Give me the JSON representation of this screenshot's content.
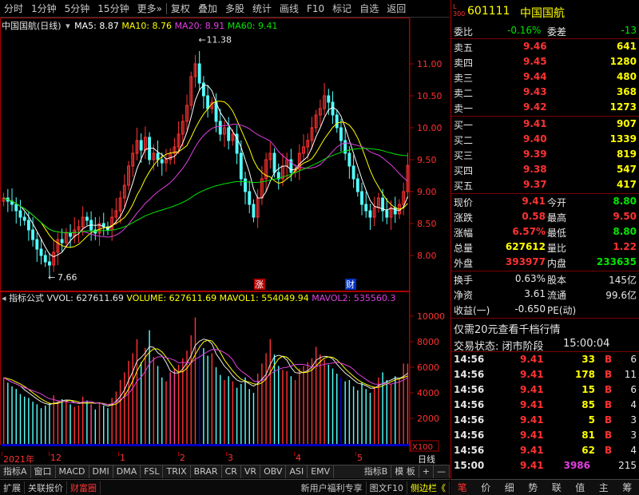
{
  "toolbar": {
    "items": [
      "分时",
      "1分钟",
      "5分钟",
      "15分钟",
      "更多»",
      "复权",
      "叠加",
      "多股",
      "统计",
      "画线",
      "F10",
      "标记",
      "自选",
      "返回"
    ]
  },
  "main_info": {
    "name": "中国国航",
    "period": "(日线)",
    "ma5": "MA5: 8.87",
    "ma10": "MA10: 8.76",
    "ma20": "MA20: 8.91",
    "ma60": "MA60: 9.41"
  },
  "markers": {
    "high": "11.38",
    "low": "7.66",
    "zhang": "涨",
    "cai": "财"
  },
  "ind_info": {
    "name": "指标公式",
    "vvol": "VVOL: 627611.69",
    "volume": "VOLUME: 627611.69",
    "mavol1": "MAVOL1: 554049.94",
    "mavol2": "MAVOL2: 535560.3"
  },
  "colors": {
    "up": "#ff3232",
    "down": "#54ffff",
    "ma5": "#ffffff",
    "ma10": "#ffff00",
    "ma20": "#e040e0",
    "ma60": "#00e600",
    "volbar_blue": "#0000ff"
  },
  "chart_data": [
    {
      "type": "candlestick",
      "title": "",
      "ylim": [
        7.5,
        11.5
      ],
      "yticks": [
        "11.00",
        "10.50",
        "10.00",
        "9.50",
        "9.00",
        "8.50",
        "8.00"
      ],
      "close": [
        8.9,
        8.85,
        8.8,
        8.7,
        8.6,
        8.55,
        8.4,
        8.25,
        8.1,
        8.0,
        7.9,
        7.85,
        8.05,
        8.25,
        8.2,
        8.35,
        8.3,
        8.4,
        8.45,
        8.6,
        8.55,
        8.4,
        8.35,
        8.5,
        8.45,
        8.4,
        8.6,
        8.7,
        8.9,
        9.1,
        9.4,
        9.6,
        9.8,
        9.65,
        9.85,
        9.5,
        9.6,
        9.5,
        9.45,
        9.5,
        9.6,
        9.7,
        9.9,
        10.1,
        10.35,
        10.8,
        11.0,
        10.7,
        10.5,
        10.3,
        10.4,
        10.1,
        9.9,
        10.0,
        9.8,
        9.9,
        9.6,
        9.2,
        9.0,
        8.8,
        8.6,
        8.9,
        9.2,
        9.5,
        9.6,
        9.3,
        9.2,
        9.4,
        9.5,
        9.3,
        9.35,
        9.6,
        9.7,
        9.8,
        10.0,
        10.2,
        10.3,
        10.5,
        10.4,
        10.2,
        10.0,
        9.8,
        9.6,
        9.4,
        9.2,
        9.0,
        8.8,
        8.7,
        8.6,
        8.75,
        8.9,
        8.7,
        8.6,
        8.75,
        8.65,
        8.8,
        9.0,
        9.41
      ],
      "ma_names": [
        "MA5",
        "MA10",
        "MA20",
        "MA60"
      ],
      "ma_last": [
        8.87,
        8.76,
        8.91,
        9.41
      ]
    },
    {
      "type": "bar",
      "title": "",
      "ylim": [
        0,
        11000
      ],
      "yticks": [
        "10000",
        "8000",
        "6000",
        "4000",
        "2000"
      ],
      "unit": "X100",
      "volume": [
        5200,
        4800,
        4500,
        4300,
        3900,
        3700,
        3600,
        3300,
        3100,
        2800,
        3000,
        3200,
        3800,
        3400,
        3500,
        3300,
        3100,
        2900,
        3000,
        3700,
        3400,
        3100,
        2700,
        3200,
        3000,
        2800,
        3600,
        4100,
        5000,
        5600,
        6500,
        7100,
        8200,
        6400,
        7500,
        8900,
        6800,
        6100,
        5200,
        4900,
        5600,
        5900,
        6200,
        6700,
        7300,
        8500,
        9900,
        7800,
        7500,
        6900,
        7100,
        6000,
        5400,
        5000,
        5300,
        4900,
        4400,
        4700,
        5200,
        4300,
        4000,
        5500,
        6300,
        7100,
        8200,
        7000,
        6100,
        5800,
        5700,
        5300,
        5000,
        5900,
        6100,
        6400,
        6700,
        7600,
        7000,
        6600,
        6200,
        5900,
        5500,
        5200,
        4900,
        5000,
        4500,
        4200,
        4800,
        4300,
        4000,
        4500,
        5200,
        5600,
        5000,
        4700,
        5300,
        5100,
        6300,
        6276
      ]
    }
  ],
  "xaxis": {
    "labels": [
      "2021年",
      "12",
      "1",
      "2",
      "3",
      "4",
      "5"
    ],
    "right": "日线"
  },
  "tabs": [
    "指标A",
    "窗口",
    "MACD",
    "DMI",
    "DMA",
    "FSL",
    "TRIX",
    "BRAR",
    "CR",
    "VR",
    "OBV",
    "ASI",
    "EMV",
    "指标B",
    "模 板",
    "+",
    "—"
  ],
  "status": {
    "items": [
      "扩展",
      "关联报价",
      "财富圈"
    ],
    "notice": "新用户福利专享",
    "f10": "图文F10",
    "side": "侧边栏《"
  },
  "quote": {
    "code": "601111",
    "name": "中国国航",
    "market": "L 300",
    "wb_label": "委比",
    "wb_value": "-0.16%",
    "wc_label": "委差",
    "wc_value": "-13",
    "asks": [
      {
        "label": "卖五",
        "price": "9.46",
        "vol": "641"
      },
      {
        "label": "卖四",
        "price": "9.45",
        "vol": "1280"
      },
      {
        "label": "卖三",
        "price": "9.44",
        "vol": "480"
      },
      {
        "label": "卖二",
        "price": "9.43",
        "vol": "368"
      },
      {
        "label": "卖一",
        "price": "9.42",
        "vol": "1273"
      }
    ],
    "bids": [
      {
        "label": "买一",
        "price": "9.41",
        "vol": "907"
      },
      {
        "label": "买二",
        "price": "9.40",
        "vol": "1339"
      },
      {
        "label": "买三",
        "price": "9.39",
        "vol": "819"
      },
      {
        "label": "买四",
        "price": "9.38",
        "vol": "547"
      },
      {
        "label": "买五",
        "price": "9.37",
        "vol": "417"
      }
    ],
    "stats": [
      {
        "l1": "现价",
        "v1": "9.41",
        "l2": "今开",
        "v2": "8.80"
      },
      {
        "l1": "涨跌",
        "v1": "0.58",
        "l2": "最高",
        "v2": "9.50"
      },
      {
        "l1": "涨幅",
        "v1": "6.57%",
        "l2": "最低",
        "v2": "8.80"
      },
      {
        "l1": "总量",
        "v1": "627612",
        "l2": "量比",
        "v2": "1.22"
      },
      {
        "l1": "外盘",
        "v1": "393977",
        "l2": "内盘",
        "v2": "233635"
      }
    ],
    "fin": [
      {
        "l1": "换手",
        "v1": "0.63%",
        "l2": "股本",
        "v2": "145亿"
      },
      {
        "l1": "净资",
        "v1": "3.61",
        "l2": "流通",
        "v2": "99.6亿"
      },
      {
        "l1": "收益(一)",
        "v1": "-0.650",
        "l2": "PE(动)",
        "v2": ""
      }
    ],
    "promo": "仅需20元查看千档行情",
    "trade_state": "交易状态: 闭市阶段",
    "trade_time": "15:00:04",
    "ticks": [
      {
        "t": "14:56",
        "p": "9.41",
        "v": "33",
        "d": "B",
        "n": "6"
      },
      {
        "t": "14:56",
        "p": "9.41",
        "v": "178",
        "d": "B",
        "n": "11"
      },
      {
        "t": "14:56",
        "p": "9.41",
        "v": "15",
        "d": "B",
        "n": "6"
      },
      {
        "t": "14:56",
        "p": "9.41",
        "v": "85",
        "d": "B",
        "n": "4"
      },
      {
        "t": "14:56",
        "p": "9.41",
        "v": "5",
        "d": "B",
        "n": "3"
      },
      {
        "t": "14:56",
        "p": "9.41",
        "v": "81",
        "d": "B",
        "n": "3"
      },
      {
        "t": "14:56",
        "p": "9.41",
        "v": "62",
        "d": "B",
        "n": "4"
      },
      {
        "t": "15:00",
        "p": "9.41",
        "v": "3986",
        "d": "",
        "n": "215"
      }
    ],
    "bottom_tabs": [
      "笔",
      "价",
      "细",
      "势",
      "联",
      "值",
      "主",
      "筹"
    ]
  }
}
